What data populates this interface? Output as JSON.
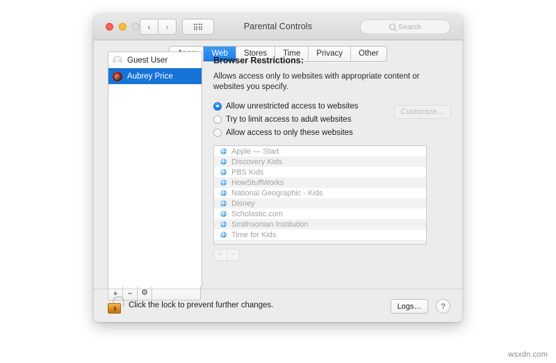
{
  "window": {
    "title": "Parental Controls",
    "traffic_lights": [
      "close-light",
      "minimize-light",
      "zoom-light"
    ],
    "nav_back": "‹",
    "nav_forward": "›",
    "grid_icon": "grid-view-icon",
    "search": {
      "placeholder": "Search",
      "value": "",
      "icon": "search-icon"
    }
  },
  "tabs": [
    {
      "label": "Apps",
      "active": false
    },
    {
      "label": "Web",
      "active": true
    },
    {
      "label": "Stores",
      "active": false
    },
    {
      "label": "Time",
      "active": false
    },
    {
      "label": "Privacy",
      "active": false
    },
    {
      "label": "Other",
      "active": false
    }
  ],
  "sidebar": {
    "users": [
      {
        "name": "Guest User",
        "selected": false,
        "avatar": "guest-avatar-icon"
      },
      {
        "name": "Aubrey Price",
        "selected": true,
        "avatar": "user-photo-avatar"
      }
    ],
    "toolbar": {
      "add": "+",
      "remove": "−",
      "settings": "⚙"
    }
  },
  "main": {
    "heading": "Browser Restrictions:",
    "description": "Allows access only to websites with appropriate content or websites you specify.",
    "options": [
      {
        "label": "Allow unrestricted access to websites",
        "selected": true
      },
      {
        "label": "Try to limit access to adult websites",
        "selected": false
      },
      {
        "label": "Allow access to only these websites",
        "selected": false
      }
    ],
    "customize_button": {
      "label": "Customize…",
      "enabled": false
    },
    "websites": [
      "Apple — Start",
      "Discovery Kids",
      "PBS Kids",
      "HowStuffWorks",
      "National Geographic - Kids",
      "Disney",
      "Scholastic.com",
      "Smithsonian Institution",
      "Time for Kids"
    ],
    "list_buttons": {
      "add": "+",
      "remove": "−",
      "enabled": false
    }
  },
  "bottom": {
    "lock_icon": "unlocked-padlock-icon",
    "lock_text": "Click the lock to prevent further changes.",
    "logs_button": "Logs…",
    "help_button": "?"
  },
  "watermark": "wsxdn.com",
  "colors": {
    "accent": "#1673d8",
    "tab_active": "#2a87ef",
    "lock_gold": "#d99225"
  }
}
